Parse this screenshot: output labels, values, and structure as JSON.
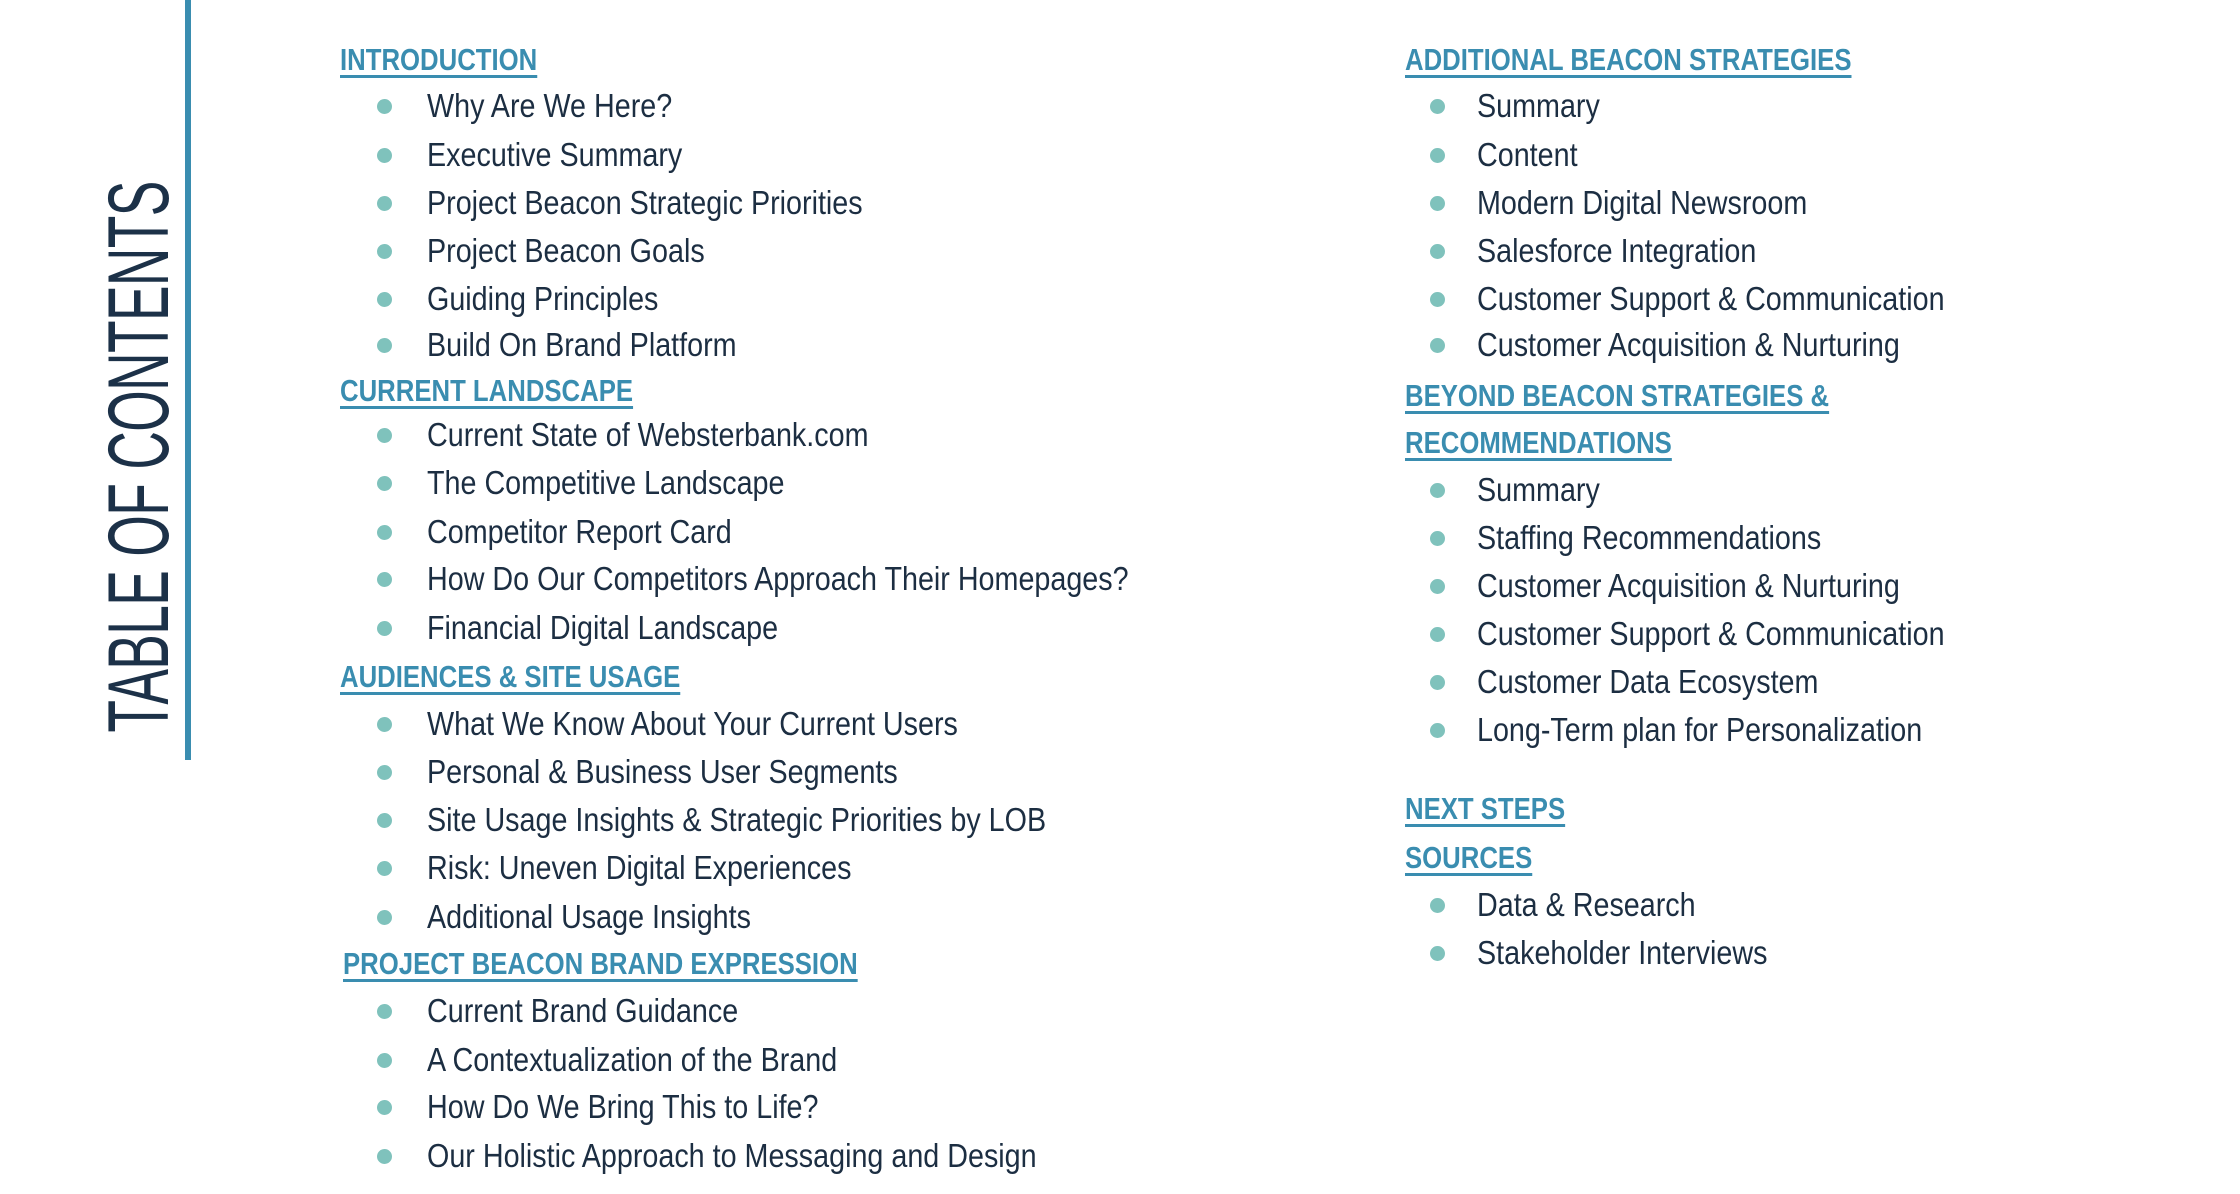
{
  "title": "TABLE OF CONTENTS",
  "colors": {
    "heading": "#3a8db0",
    "divider": "#3a8db0",
    "bullet": "#7fc2bc",
    "text": "#1c2e42",
    "title": "#1c3148"
  },
  "left_column": [
    {
      "heading": "INTRODUCTION",
      "items": [
        "Why Are We Here?",
        "Executive Summary",
        "Project Beacon Strategic Priorities",
        "Project Beacon Goals",
        "Guiding Principles",
        "Build On Brand Platform"
      ]
    },
    {
      "heading": "CURRENT LANDSCAPE",
      "items": [
        "Current State of Websterbank.com",
        "The Competitive Landscape",
        "Competitor Report Card",
        "How Do Our Competitors Approach Their Homepages?",
        "Financial Digital Landscape"
      ]
    },
    {
      "heading": "AUDIENCES & SITE USAGE",
      "items": [
        "What We Know About Your Current Users",
        "Personal & Business User Segments",
        "Site Usage Insights & Strategic Priorities by LOB",
        "Risk: Uneven Digital Experiences",
        "Additional Usage Insights"
      ]
    },
    {
      "heading": "PROJECT BEACON BRAND EXPRESSION",
      "items": [
        "Current Brand Guidance",
        "A Contextualization of the Brand",
        "How Do We Bring This to Life?",
        "Our Holistic Approach to Messaging and Design"
      ]
    }
  ],
  "right_column": [
    {
      "heading": "ADDITIONAL BEACON STRATEGIES",
      "items": [
        "Summary",
        "Content",
        "Modern Digital Newsroom",
        "Salesforce Integration",
        "Customer Support & Communication",
        "Customer Acquisition & Nurturing"
      ]
    },
    {
      "heading_lines": [
        "BEYOND BEACON STRATEGIES &",
        "RECOMMENDATIONS"
      ],
      "items": [
        "Summary",
        "Staffing Recommendations",
        "Customer Acquisition & Nurturing",
        "Customer Support & Communication",
        "Customer Data Ecosystem",
        "Long-Term plan for Personalization"
      ]
    },
    {
      "heading": "NEXT STEPS",
      "items": []
    },
    {
      "heading": "SOURCES",
      "items": [
        "Data & Research",
        "Stakeholder Interviews"
      ]
    }
  ]
}
